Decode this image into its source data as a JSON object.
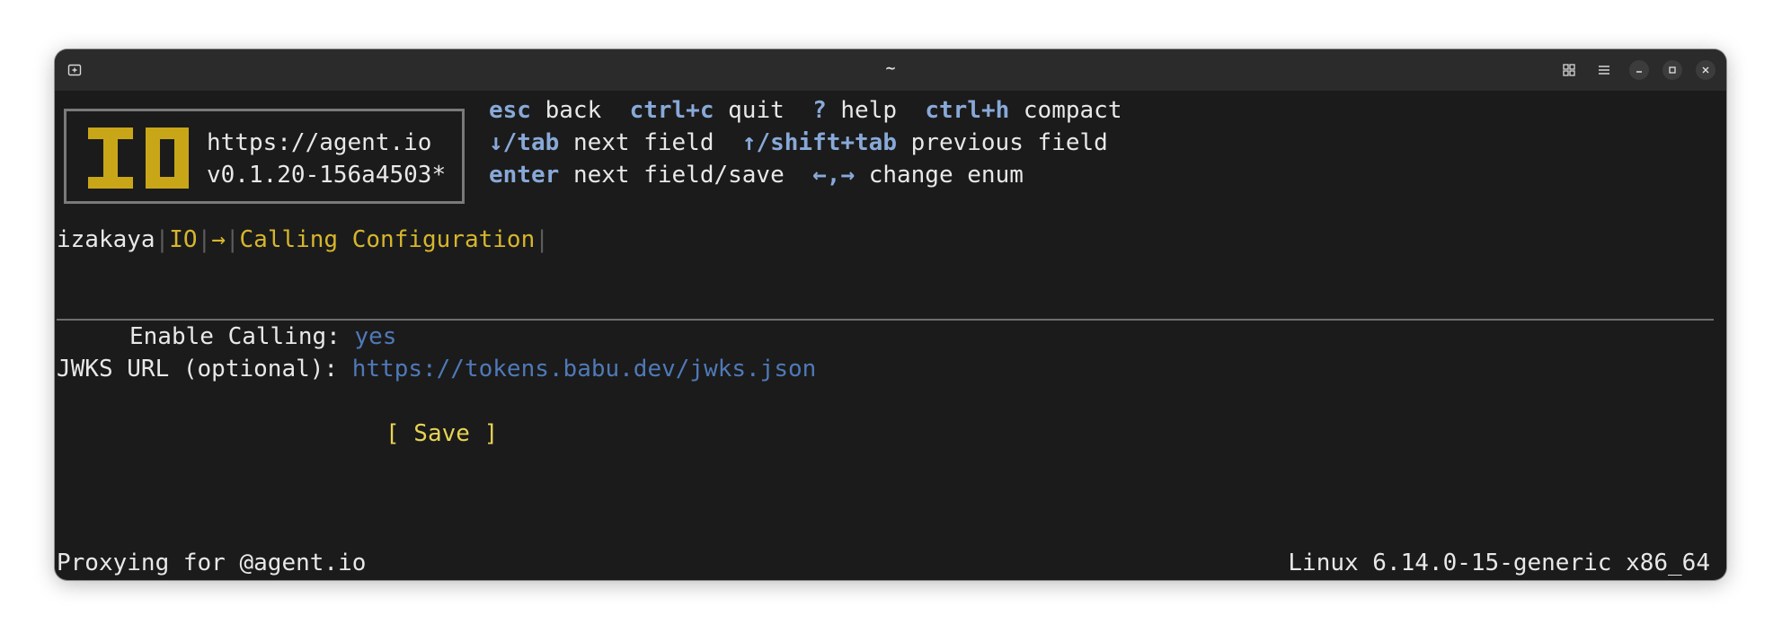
{
  "window": {
    "title": "~"
  },
  "logo": {
    "url": "https://agent.io",
    "version": "v0.1.20-156a4503*",
    "brand_color": "#c9a618"
  },
  "help": {
    "row1": [
      {
        "key": "esc",
        "label": "back"
      },
      {
        "key": "ctrl+c",
        "label": "quit"
      },
      {
        "key": "?",
        "label": "help"
      },
      {
        "key": "ctrl+h",
        "label": "compact"
      }
    ],
    "row2": [
      {
        "key": "↓/tab",
        "label": "next field"
      },
      {
        "key": "↑/shift+tab",
        "label": "previous field"
      }
    ],
    "row3": [
      {
        "key": "enter",
        "label": "next field/save"
      },
      {
        "key": "←,→",
        "label": "change enum"
      }
    ]
  },
  "breadcrumb": {
    "app": "izakaya",
    "sep": "|",
    "org": "IO",
    "arrow": "→",
    "page": "Calling Configuration"
  },
  "form": {
    "enable_calling_label": "Enable Calling:",
    "enable_calling_value": "yes",
    "jwks_label": "JWKS URL (optional):",
    "jwks_value": "https://tokens.babu.dev/jwks.json",
    "save_label": "[ Save ]"
  },
  "status": {
    "left": "Proxying for @agent.io",
    "right": "Linux 6.14.0-15-generic x86_64"
  },
  "colors": {
    "key": "#88a9d8",
    "accent": "#d6b62d",
    "value": "#4f79b8",
    "save": "#e6d353",
    "background": "#1b1b1b"
  }
}
